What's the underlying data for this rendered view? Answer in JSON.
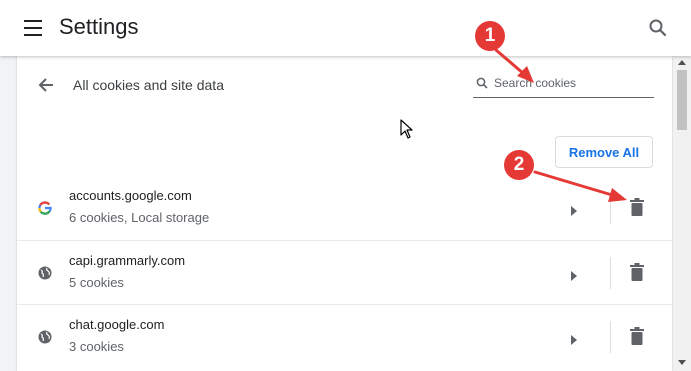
{
  "header": {
    "title": "Settings",
    "menu_icon": "hamburger-menu-icon",
    "search_icon": "search-icon"
  },
  "subpage": {
    "title": "All cookies and site data",
    "back_icon": "arrow-back-icon",
    "search": {
      "placeholder": "Search cookies",
      "value": ""
    },
    "remove_all_label": "Remove All"
  },
  "sites": [
    {
      "domain": "accounts.google.com",
      "info": "6 cookies, Local storage",
      "icon": "google-logo-icon"
    },
    {
      "domain": "capi.grammarly.com",
      "info": "5 cookies",
      "icon": "globe-icon"
    },
    {
      "domain": "chat.google.com",
      "info": "3 cookies",
      "icon": "globe-icon"
    }
  ],
  "annotations": [
    {
      "number": "1",
      "target": "search cookies field"
    },
    {
      "number": "2",
      "target": "delete button"
    }
  ],
  "colors": {
    "accent": "#1a73e8",
    "annotation": "#e53935",
    "background": "#f1f3f4"
  }
}
